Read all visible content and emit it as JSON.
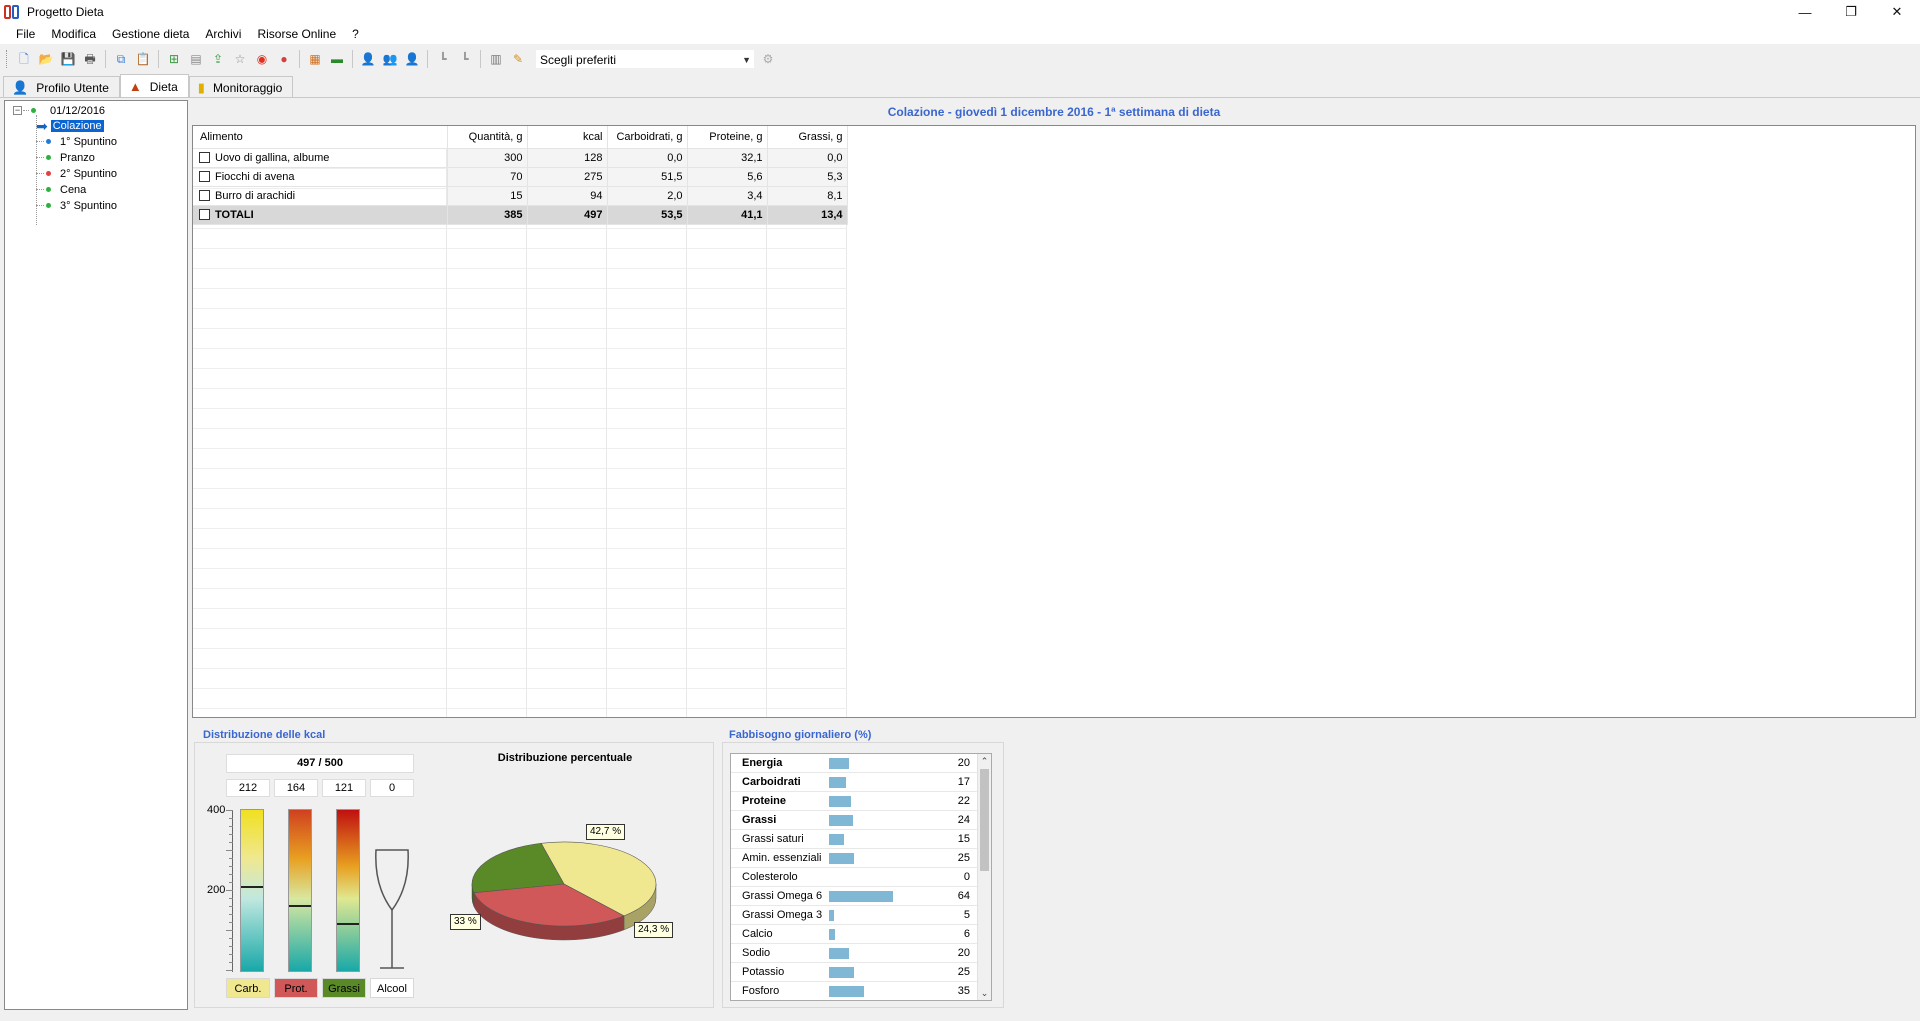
{
  "window": {
    "title": "Progetto Dieta",
    "minimize": "—",
    "restore": "❐",
    "close": "✕"
  },
  "menu": [
    "File",
    "Modifica",
    "Gestione dieta",
    "Archivi",
    "Risorse Online",
    "?"
  ],
  "toolbar": {
    "favorites_placeholder": "Scegli preferiti",
    "icons": [
      "new-file-icon",
      "open-folder-icon",
      "save-icon",
      "print-icon",
      "copy-icon",
      "paste-icon",
      "add-food-icon",
      "list-icon",
      "export-icon",
      "favorite-icon",
      "target-icon",
      "chart-icon",
      "table-icon",
      "bars-icon",
      "user-icon",
      "users-icon",
      "user-gray-icon",
      "tool-icon",
      "tool2-icon",
      "gift-icon",
      "edit-icon"
    ]
  },
  "tabs": [
    {
      "label": "Profilo Utente",
      "icon": "user-profile-icon",
      "active": false
    },
    {
      "label": "Dieta",
      "icon": "diet-icon",
      "active": true
    },
    {
      "label": "Monitoraggio",
      "icon": "monitor-icon",
      "active": false
    }
  ],
  "tree": {
    "date": "01/12/2016",
    "expander": "−",
    "items": [
      {
        "label": "Colazione",
        "color": "#1565c0",
        "selected": true
      },
      {
        "label": "1° Spuntino",
        "color": "#1f7ad8",
        "selected": false
      },
      {
        "label": "Pranzo",
        "color": "#2cb040",
        "selected": false
      },
      {
        "label": "2° Spuntino",
        "color": "#e04040",
        "selected": false
      },
      {
        "label": "Cena",
        "color": "#2cb040",
        "selected": false
      },
      {
        "label": "3° Spuntino",
        "color": "#2cb040",
        "selected": false
      }
    ]
  },
  "meal": {
    "header": "Colazione - giovedì 1 dicembre 2016 - 1ª settimana di dieta",
    "columns": [
      "Alimento",
      "Quantità, g",
      "kcal",
      "Carboidrati, g",
      "Proteine, g",
      "Grassi, g"
    ],
    "rows": [
      [
        "Uovo di gallina, albume",
        "300",
        "128",
        "0,0",
        "32,1",
        "0,0"
      ],
      [
        "Fiocchi di avena",
        "70",
        "275",
        "51,5",
        "5,6",
        "5,3"
      ],
      [
        "Burro di arachidi",
        "15",
        "94",
        "2,0",
        "3,4",
        "8,1"
      ]
    ],
    "totals": [
      "TOTALI",
      "385",
      "497",
      "53,5",
      "41,1",
      "13,4"
    ]
  },
  "kcal_distribution": {
    "title": "Distribuzione delle kcal",
    "total": "497 / 500",
    "values": [
      "212",
      "164",
      "121",
      "0"
    ],
    "axis": [
      "400",
      "200"
    ],
    "bar_levels": [
      0.53,
      0.41,
      0.3,
      0
    ],
    "legend": [
      {
        "label": "Carb.",
        "color": "#f0e890"
      },
      {
        "label": "Prot.",
        "color": "#d05858"
      },
      {
        "label": "Grassi",
        "color": "#5a8a28"
      },
      {
        "label": "Alcool",
        "color": "#ffffff"
      }
    ]
  },
  "pie": {
    "title": "Distribuzione percentuale",
    "labels": [
      "42,7 %",
      "33 %",
      "24,3 %"
    ]
  },
  "chart_data": {
    "type": "pie",
    "title": "Distribuzione percentuale",
    "categories": [
      "Carboidrati",
      "Proteine",
      "Grassi"
    ],
    "values": [
      42.7,
      33.0,
      24.3
    ],
    "colors": [
      "#f0e890",
      "#d05858",
      "#5a8a28"
    ]
  },
  "fabbisogno": {
    "title": "Fabbisogno giornaliero (%)",
    "scroll_up": "⌃",
    "scroll_down": "⌄",
    "rows": [
      {
        "name": "Energia",
        "value": "20",
        "pct": 20,
        "bold": true
      },
      {
        "name": "Carboidrati",
        "value": "17",
        "pct": 17,
        "bold": true
      },
      {
        "name": "Proteine",
        "value": "22",
        "pct": 22,
        "bold": true
      },
      {
        "name": "Grassi",
        "value": "24",
        "pct": 24,
        "bold": true
      },
      {
        "name": "Grassi saturi",
        "value": "15",
        "pct": 15,
        "bold": false
      },
      {
        "name": "Amin. essenziali",
        "value": "25",
        "pct": 25,
        "bold": false
      },
      {
        "name": "Colesterolo",
        "value": "0",
        "pct": 0,
        "bold": false
      },
      {
        "name": "Grassi Omega 6",
        "value": "64",
        "pct": 64,
        "bold": false
      },
      {
        "name": "Grassi Omega 3",
        "value": "5",
        "pct": 5,
        "bold": false
      },
      {
        "name": "Calcio",
        "value": "6",
        "pct": 6,
        "bold": false
      },
      {
        "name": "Sodio",
        "value": "20",
        "pct": 20,
        "bold": false
      },
      {
        "name": "Potassio",
        "value": "25",
        "pct": 25,
        "bold": false
      },
      {
        "name": "Fosforo",
        "value": "35",
        "pct": 35,
        "bold": false
      }
    ]
  }
}
